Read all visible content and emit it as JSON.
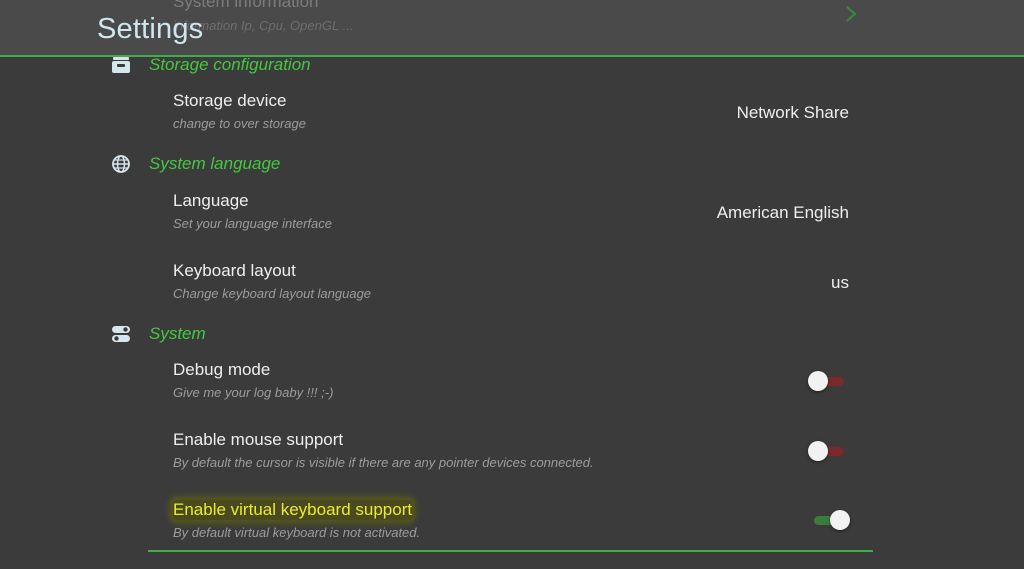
{
  "header": {
    "title": "Settings",
    "ghost_row": {
      "title": "System information",
      "subtitle": "information Ip, Cpu, OpenGL ..."
    }
  },
  "sections": {
    "storage": {
      "title": "Storage configuration",
      "icon": "storage-drawer-icon",
      "rows": {
        "device": {
          "title": "Storage device",
          "subtitle": "change to over storage",
          "value": "Network Share"
        }
      }
    },
    "language": {
      "title": "System language",
      "icon": "globe-icon",
      "rows": {
        "language": {
          "title": "Language",
          "subtitle": "Set your language interface",
          "value": "American English"
        },
        "keyboard_layout": {
          "title": "Keyboard layout",
          "subtitle": "Change keyboard layout language",
          "value": "us"
        }
      }
    },
    "system": {
      "title": "System",
      "icon": "toggles-icon",
      "rows": {
        "debug": {
          "title": "Debug mode",
          "subtitle": "Give me your log baby !!! ;-)",
          "state": "off"
        },
        "mouse": {
          "title": "Enable mouse support",
          "subtitle": "By default the cursor is visible if there are any pointer devices connected.",
          "state": "off"
        },
        "virtual_keyboard": {
          "title": "Enable virtual keyboard support",
          "subtitle": "By default virtual keyboard is not activated.",
          "state": "on",
          "highlighted": true
        }
      }
    }
  },
  "colors": {
    "accent_green": "#45c742",
    "title_blue": "#cfe6ee",
    "highlight_yellow": "#ecec2a",
    "toggle_off_track": "#7a2a2a",
    "toggle_on_track": "#3a7d3d"
  }
}
